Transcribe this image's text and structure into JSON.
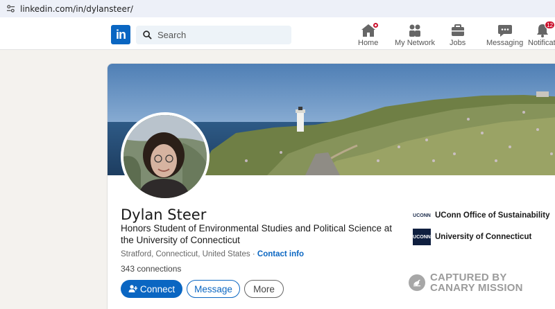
{
  "browser": {
    "url": "linkedin.com/in/dylansteer/"
  },
  "nav": {
    "logo_text": "in",
    "search_placeholder": "Search",
    "items": [
      {
        "label": "Home",
        "icon": "home-icon",
        "badge": "dot"
      },
      {
        "label": "My Network",
        "icon": "network-icon"
      },
      {
        "label": "Jobs",
        "icon": "briefcase-icon"
      },
      {
        "label": "Messaging",
        "icon": "messaging-icon"
      },
      {
        "label": "Notificati",
        "icon": "bell-icon",
        "badge": "12"
      }
    ],
    "notifications_badge": "12"
  },
  "profile": {
    "name": "Dylan Steer",
    "headline": "Honors Student of Environmental Studies and Political Science at the University of Connecticut",
    "location": "Stratford, Connecticut, United States",
    "separator": "·",
    "contact_info": "Contact info",
    "connections": "343 connections",
    "buttons": {
      "connect": "Connect",
      "message": "Message",
      "more": "More"
    },
    "organizations": [
      {
        "logo_text": "UCONN",
        "name": "UConn Office of Sustainability"
      },
      {
        "logo_text": "UCONN",
        "name": "University of Connecticut"
      }
    ]
  },
  "watermark": {
    "line1": "CAPTURED BY",
    "line2": "CANARY MISSION"
  },
  "colors": {
    "brand": "#0a66c2",
    "badge": "#cb112d",
    "page_bg": "#f4f2ee"
  }
}
